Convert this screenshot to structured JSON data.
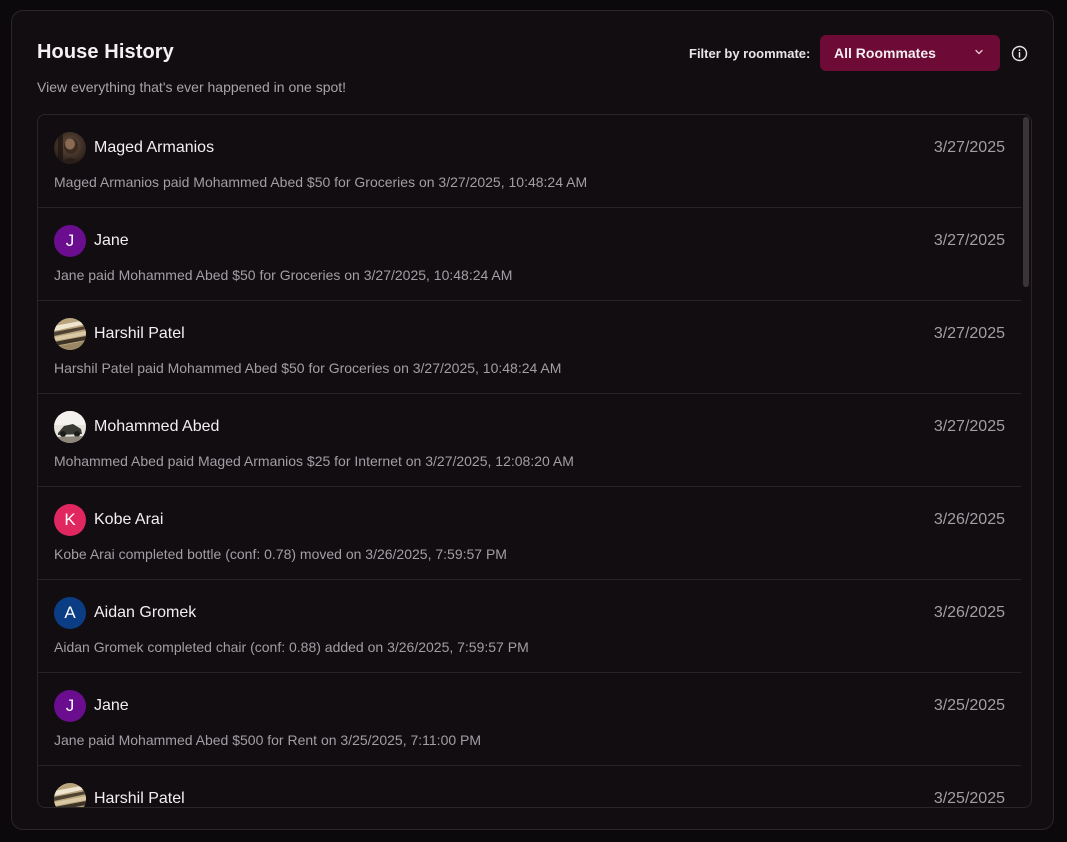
{
  "header": {
    "title": "House History",
    "subtitle": "View everything that's ever happened in one spot!",
    "filter_label": "Filter by roommate:",
    "filter_value": "All Roommates",
    "accent_color": "#6d0a35"
  },
  "history": [
    {
      "name": "Maged Armanios",
      "date": "3/27/2025",
      "description": "Maged Armanios paid Mohammed Abed $50 for Groceries on 3/27/2025, 10:48:24 AM",
      "avatar": {
        "type": "photo",
        "icon": "portrait-photo"
      }
    },
    {
      "name": "Jane",
      "date": "3/27/2025",
      "description": "Jane paid Mohammed Abed $50 for Groceries on 3/27/2025, 10:48:24 AM",
      "avatar": {
        "type": "initial",
        "initial": "J",
        "color": "#6a0d8f"
      }
    },
    {
      "name": "Harshil Patel",
      "date": "3/27/2025",
      "description": "Harshil Patel paid Mohammed Abed $50 for Groceries on 3/27/2025, 10:48:24 AM",
      "avatar": {
        "type": "photo",
        "icon": "landscape-photo"
      }
    },
    {
      "name": "Mohammed Abed",
      "date": "3/27/2025",
      "description": "Mohammed Abed paid Maged Armanios $25 for Internet on 3/27/2025, 12:08:20 AM",
      "avatar": {
        "type": "photo",
        "icon": "vehicle-photo"
      }
    },
    {
      "name": "Kobe Arai",
      "date": "3/26/2025",
      "description": "Kobe Arai completed bottle (conf: 0.78) moved on 3/26/2025, 7:59:57 PM",
      "avatar": {
        "type": "initial",
        "initial": "K",
        "color": "#e0275f"
      }
    },
    {
      "name": "Aidan Gromek",
      "date": "3/26/2025",
      "description": "Aidan Gromek completed chair (conf: 0.88) added on 3/26/2025, 7:59:57 PM",
      "avatar": {
        "type": "initial",
        "initial": "A",
        "color": "#0b3d85"
      }
    },
    {
      "name": "Jane",
      "date": "3/25/2025",
      "description": "Jane paid Mohammed Abed $500 for Rent on 3/25/2025, 7:11:00 PM",
      "avatar": {
        "type": "initial",
        "initial": "J",
        "color": "#6a0d8f"
      }
    },
    {
      "name": "Harshil Patel",
      "date": "3/25/2025",
      "description": "",
      "avatar": {
        "type": "photo",
        "icon": "landscape-photo"
      }
    }
  ]
}
